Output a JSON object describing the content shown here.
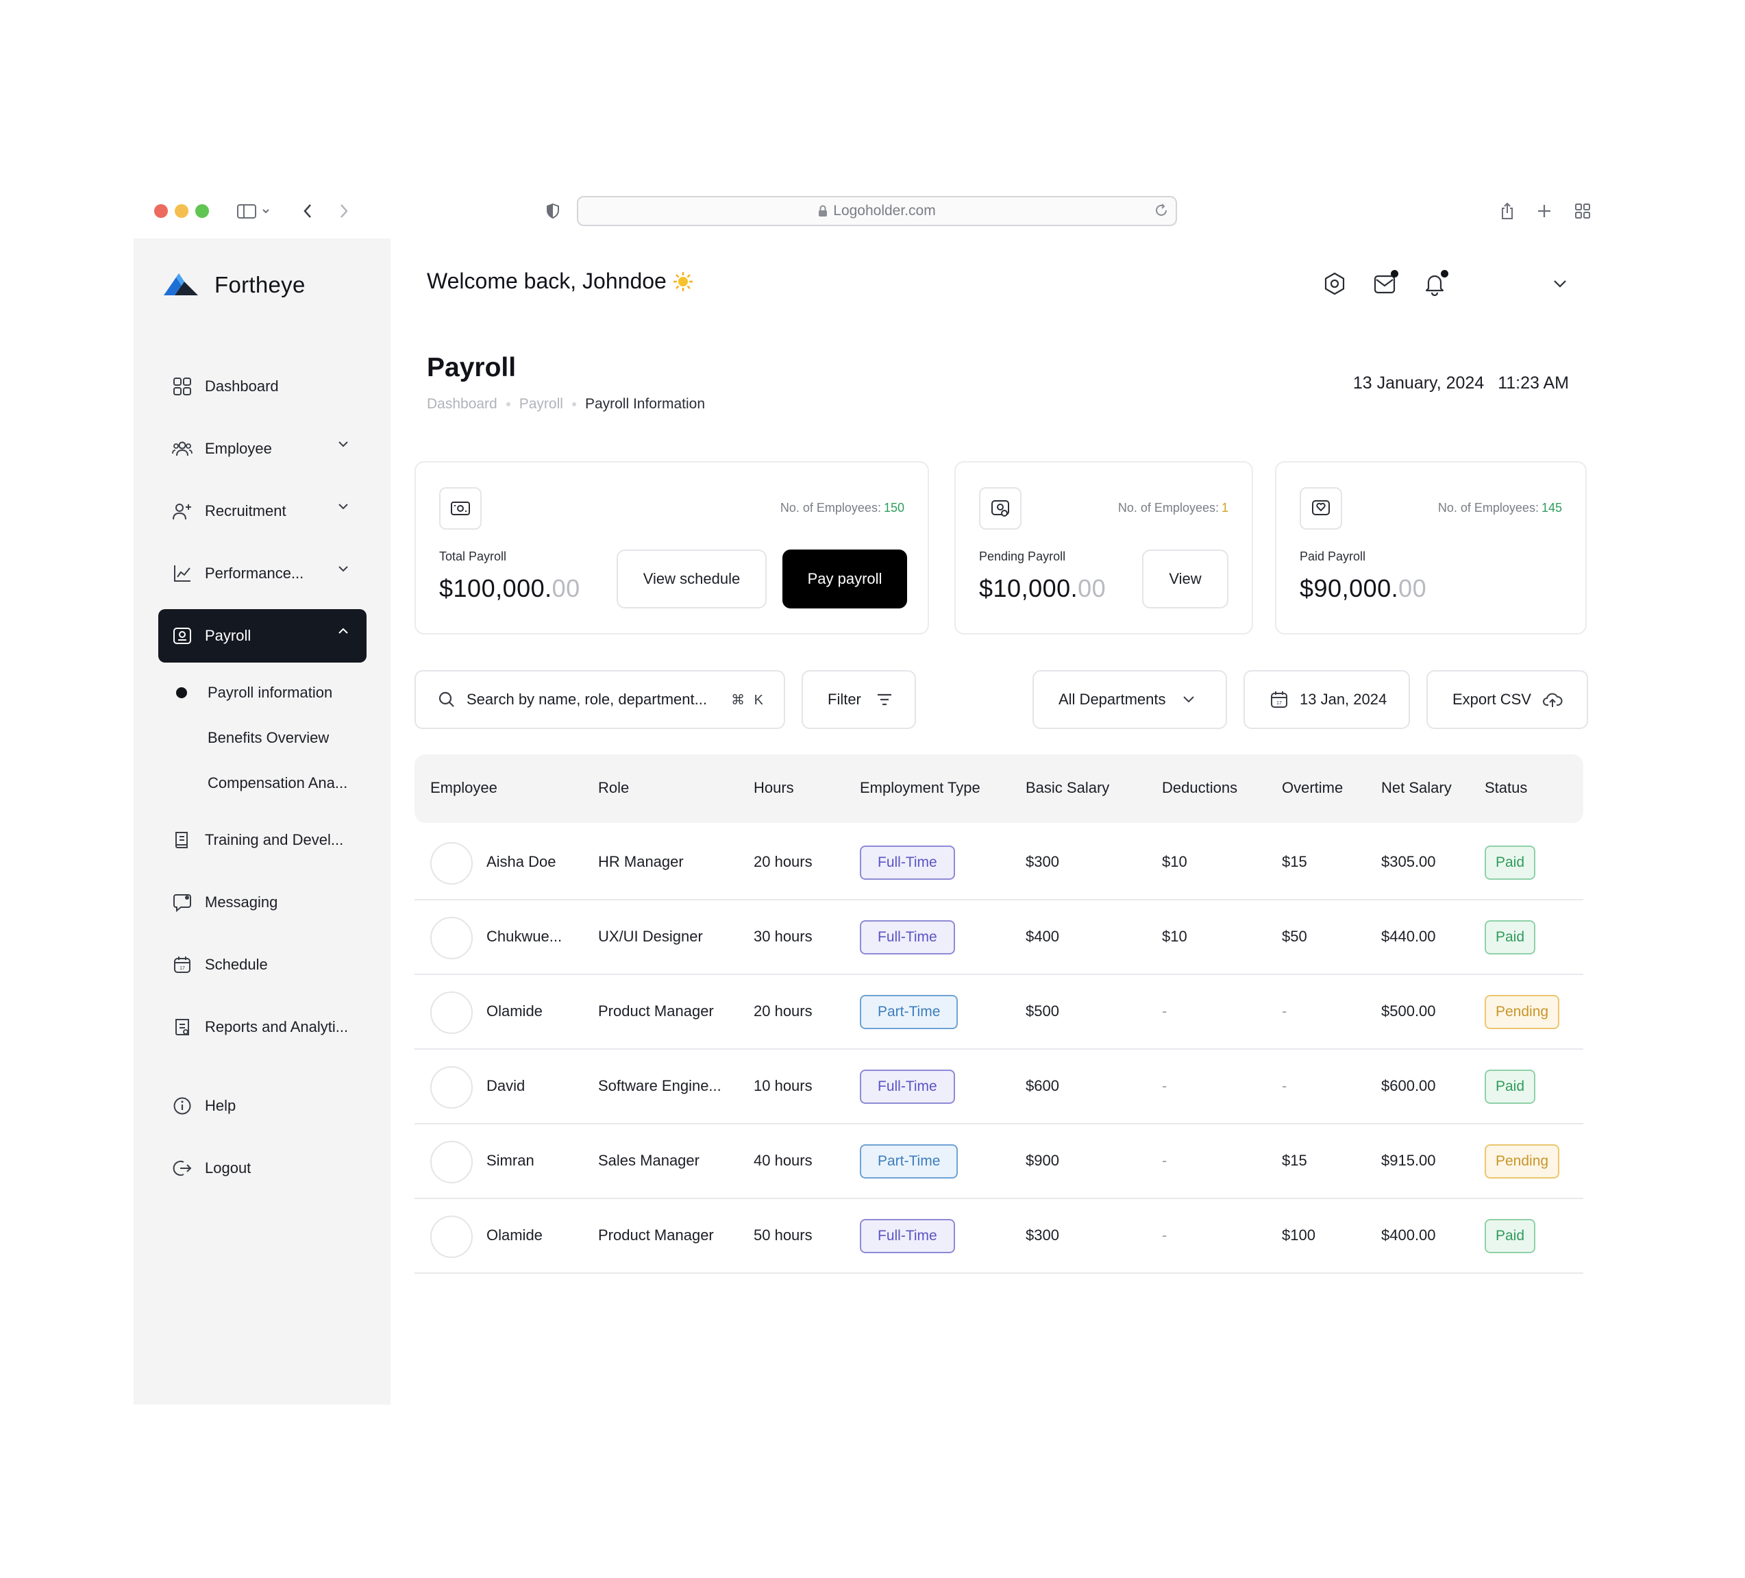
{
  "browser": {
    "url": "Logoholder.com"
  },
  "brand": {
    "name": "Fortheye"
  },
  "sidebar": {
    "items": [
      {
        "label": "Dashboard"
      },
      {
        "label": "Employee"
      },
      {
        "label": "Recruitment"
      },
      {
        "label": "Performance..."
      },
      {
        "label": "Payroll"
      },
      {
        "label": "Training and Devel..."
      },
      {
        "label": "Messaging"
      },
      {
        "label": "Schedule"
      },
      {
        "label": "Reports and Analyti..."
      },
      {
        "label": "Help"
      },
      {
        "label": "Logout"
      }
    ],
    "payroll_sub": [
      {
        "label": "Payroll information"
      },
      {
        "label": "Benefits Overview"
      },
      {
        "label": "Compensation Ana..."
      }
    ]
  },
  "header": {
    "welcome": "Welcome back, Johndoe"
  },
  "page": {
    "title": "Payroll",
    "breadcrumb": [
      "Dashboard",
      "Payroll",
      "Payroll Information"
    ],
    "date": "13 January, 2024",
    "time": "11:23 AM"
  },
  "cards": [
    {
      "count_label": "No. of Employees:",
      "count": "150",
      "count_color": "#2f9c5b",
      "label": "Total Payroll",
      "amount": "$100,000.",
      "cents": "00"
    },
    {
      "count_label": "No. of Employees:",
      "count": "1",
      "count_color": "#d0a020",
      "label": "Pending Payroll",
      "amount": "$10,000.",
      "cents": "00"
    },
    {
      "count_label": "No. of Employees:",
      "count": "145",
      "count_color": "#2f9c5b",
      "label": "Paid Payroll",
      "amount": "$90,000.",
      "cents": "00"
    }
  ],
  "buttons": {
    "view_schedule": "View schedule",
    "pay_payroll": "Pay payroll",
    "view": "View"
  },
  "toolbar": {
    "search_placeholder": "Search by name, role, department...",
    "shortcut": "⌘ K",
    "filter": "Filter",
    "department": "All Departments",
    "date": "13 Jan, 2024",
    "export": "Export CSV"
  },
  "table": {
    "columns": [
      "Employee",
      "Role",
      "Hours",
      "Employment Type",
      "Basic Salary",
      "Deductions",
      "Overtime",
      "Net Salary",
      "Status"
    ],
    "rows": [
      {
        "name": "Aisha Doe",
        "role": "HR Manager",
        "hours": "20 hours",
        "type": "Full-Time",
        "basic": "$300",
        "deductions": "$10",
        "overtime": "$15",
        "net": "$305.00",
        "status": "Paid"
      },
      {
        "name": "Chukwue...",
        "role": "UX/UI Designer",
        "hours": "30 hours",
        "type": "Full-Time",
        "basic": "$400",
        "deductions": "$10",
        "overtime": "$50",
        "net": "$440.00",
        "status": "Paid"
      },
      {
        "name": "Olamide",
        "role": "Product Manager",
        "hours": "20 hours",
        "type": "Part-Time",
        "basic": "$500",
        "deductions": "-",
        "overtime": "-",
        "net": "$500.00",
        "status": "Pending"
      },
      {
        "name": "David",
        "role": "Software Engine...",
        "hours": "10 hours",
        "type": "Full-Time",
        "basic": "$600",
        "deductions": "-",
        "overtime": "-",
        "net": "$600.00",
        "status": "Paid"
      },
      {
        "name": "Simran",
        "role": "Sales Manager",
        "hours": "40 hours",
        "type": "Part-Time",
        "basic": "$900",
        "deductions": "-",
        "overtime": "$15",
        "net": "$915.00",
        "status": "Pending"
      },
      {
        "name": "Olamide",
        "role": "Product Manager",
        "hours": "50 hours",
        "type": "Full-Time",
        "basic": "$300",
        "deductions": "-",
        "overtime": "$100",
        "net": "$400.00",
        "status": "Paid"
      }
    ]
  }
}
